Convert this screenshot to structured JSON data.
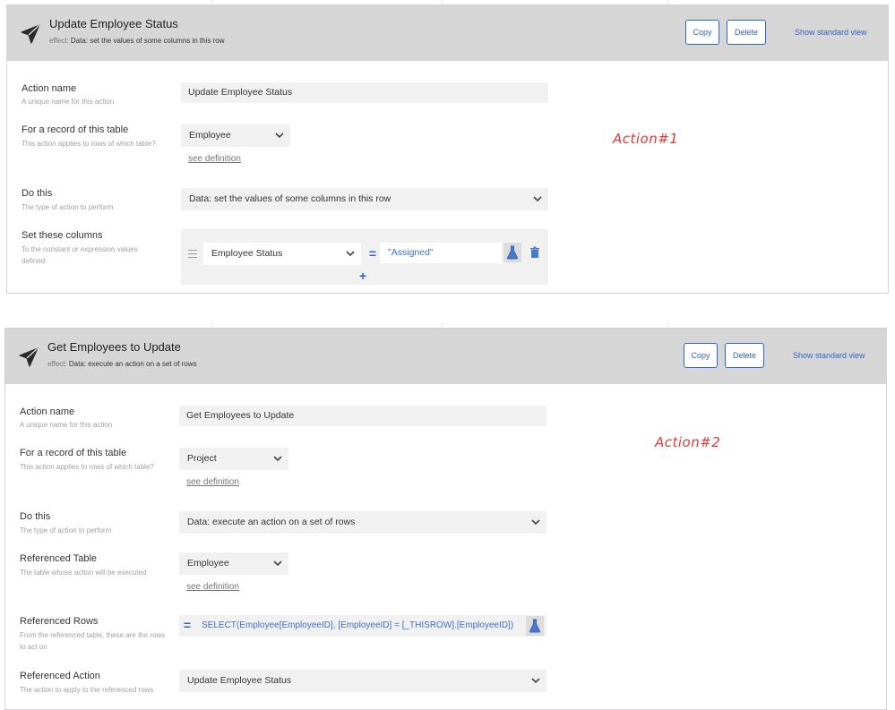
{
  "accent_color": "#2f66c6",
  "annotation_color": "#e53935",
  "actions": [
    {
      "header": {
        "title": "Update Employee Status",
        "effect_prefix": "effect:",
        "effect_value": "Data: set the values of some columns in this row",
        "copy_label": "Copy",
        "delete_label": "Delete",
        "show_standard_label": "Show standard view",
        "icon": "send-icon"
      },
      "action_name": {
        "label": "Action name",
        "help": "A unique name for this action",
        "value": "Update Employee Status"
      },
      "table": {
        "label": "For a record of this table",
        "help": "This action applies to rows of which table?",
        "value": "Employee",
        "see_definition": "see definition"
      },
      "do_this": {
        "label": "Do this",
        "help": "The type of action to perform",
        "value": "Data: set the values of some columns in this row"
      },
      "set_columns": {
        "label": "Set these columns",
        "help": "To the constant or expression values defined",
        "column": "Employee Status",
        "equals": "=",
        "expression": "\"Assigned\"",
        "add": "+"
      },
      "annotation": "Action#1"
    },
    {
      "header": {
        "title": "Get Employees to Update",
        "effect_prefix": "effect:",
        "effect_value": "Data: execute an action on a set of rows",
        "copy_label": "Copy",
        "delete_label": "Delete",
        "show_standard_label": "Show standard view",
        "icon": "send-icon"
      },
      "action_name": {
        "label": "Action name",
        "help": "A unique name for this action",
        "value": "Get Employees to Update"
      },
      "table": {
        "label": "For a record of this table",
        "help": "This action applies to rows of which table?",
        "value": "Project",
        "see_definition": "see definition"
      },
      "do_this": {
        "label": "Do this",
        "help": "The type of action to perform",
        "value": "Data: execute an action on a set of rows"
      },
      "referenced_table": {
        "label": "Referenced Table",
        "help": "The table whose action will be executed",
        "value": "Employee",
        "see_definition": "see definition"
      },
      "referenced_rows": {
        "label": "Referenced Rows",
        "help": "From the referenced table, these are the rows to act on",
        "equals": "=",
        "expression": "SELECT(Employee[EmployeeID], [EmployeeID] = [_THISROW].[EmployeeID])"
      },
      "referenced_action": {
        "label": "Referenced Action",
        "help": "The action to apply to the referenced rows",
        "value": "Update Employee Status"
      },
      "annotation": "Action#2"
    }
  ]
}
